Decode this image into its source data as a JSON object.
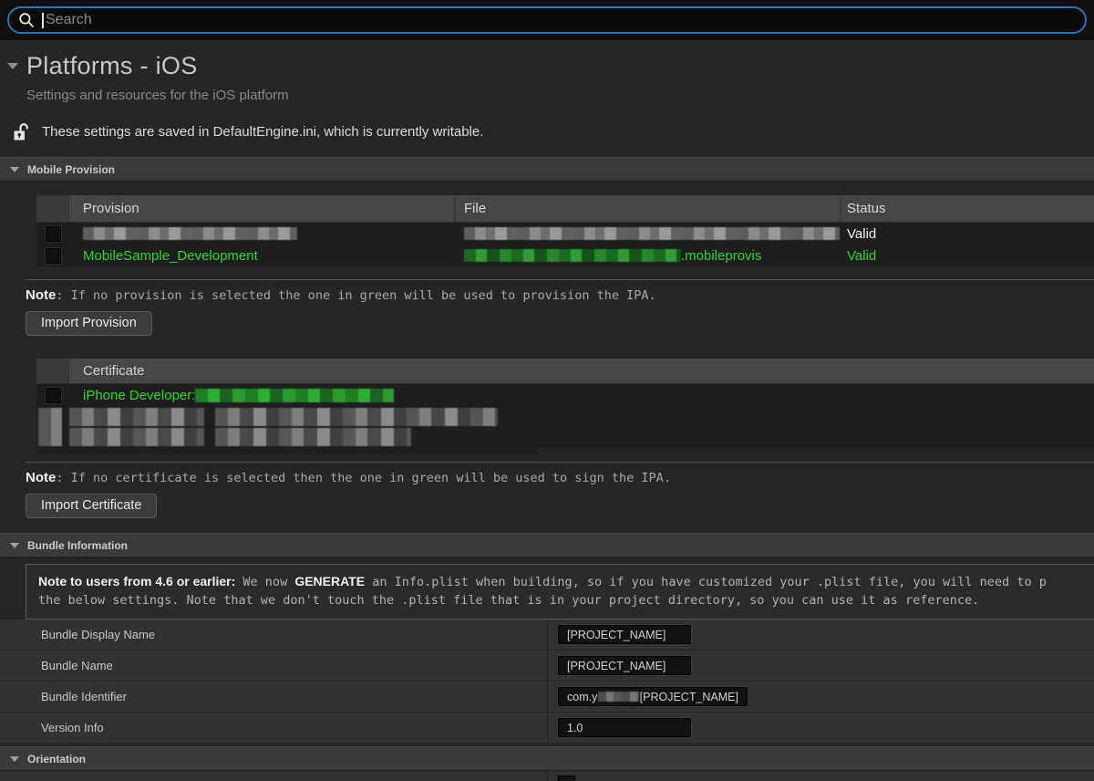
{
  "search": {
    "placeholder": "Search"
  },
  "page": {
    "title": "Platforms - iOS",
    "subtitle": "Settings and resources for the iOS platform",
    "config_notice": "These settings are saved in DefaultEngine.ini, which is currently writable."
  },
  "sections": {
    "mobile_provision": {
      "label": "Mobile Provision"
    },
    "bundle_information": {
      "label": "Bundle Information"
    },
    "orientation": {
      "label": "Orientation"
    }
  },
  "provision_table": {
    "columns": {
      "provision": "Provision",
      "file": "File",
      "status": "Status"
    },
    "rows": [
      {
        "provision": "[redacted]",
        "file": "[redacted]",
        "status": "Valid",
        "highlighted": false
      },
      {
        "provision": "MobileSample_Development",
        "file_redacted": true,
        "file_suffix": ".mobileprovis",
        "status": "Valid",
        "highlighted": true
      }
    ],
    "note_label": "Note",
    "note_text": ": If no provision is selected the one in green will be used to provision the IPA.",
    "import_button": "Import Provision"
  },
  "certificate_table": {
    "columns": {
      "certificate": "Certificate"
    },
    "rows": [
      {
        "certificate": "iPhone Developer: ",
        "name_redacted": true,
        "highlighted": true
      },
      {
        "certificate": "[redacted]",
        "highlighted": false
      }
    ],
    "note_label": "Note",
    "note_text": ": If no certificate is selected then the one in green will be used to sign the IPA.",
    "import_button": "Import Certificate"
  },
  "bundle_info": {
    "notice": {
      "bold_intro": "Note to users from 4.6 or earlier:",
      "mono_1": " We now ",
      "bold_generate": "GENERATE",
      "mono_2": " an Info.plist when building, so if you have customized your .plist file, you will need to p",
      "line2": "the below settings. Note that we don't touch the .plist file that is in your project directory, so you can use it as reference."
    },
    "rows": [
      {
        "label": "Bundle Display Name",
        "value": "[PROJECT_NAME]"
      },
      {
        "label": "Bundle Name",
        "value": "[PROJECT_NAME]"
      },
      {
        "label": "Bundle Identifier",
        "value_prefix": "com.y",
        "value_redacted": true,
        "value_suffix": "[PROJECT_NAME]"
      },
      {
        "label": "Version Info",
        "value": "1.0"
      }
    ]
  },
  "colors": {
    "accent_blue": "#2e6fb8",
    "highlight_green": "#2cd82c",
    "valid_white": "#f2f2f2"
  }
}
